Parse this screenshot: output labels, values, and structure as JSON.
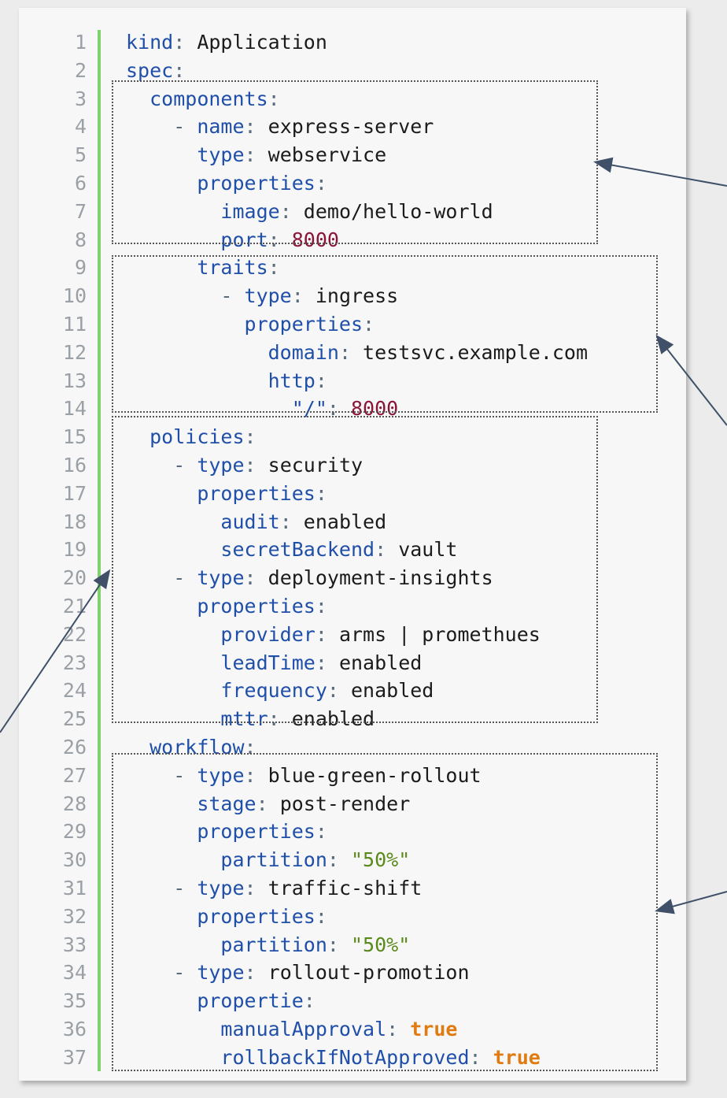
{
  "editor": {
    "lines": [
      {
        "num": "1",
        "indent": "",
        "key": "kind",
        "value": "Application",
        "vtype": "plain"
      },
      {
        "num": "2",
        "indent": "",
        "key": "spec",
        "value": "",
        "vtype": "plain"
      },
      {
        "num": "3",
        "indent": "  ",
        "key": "components",
        "value": "",
        "vtype": "plain"
      },
      {
        "num": "4",
        "indent": "    - ",
        "key": "name",
        "value": "express-server",
        "vtype": "plain"
      },
      {
        "num": "5",
        "indent": "      ",
        "key": "type",
        "value": "webservice",
        "vtype": "plain"
      },
      {
        "num": "6",
        "indent": "      ",
        "key": "properties",
        "value": "",
        "vtype": "plain"
      },
      {
        "num": "7",
        "indent": "        ",
        "key": "image",
        "value": "demo/hello-world",
        "vtype": "plain"
      },
      {
        "num": "8",
        "indent": "        ",
        "key": "port",
        "value": "8000",
        "vtype": "number"
      },
      {
        "num": "9",
        "indent": "      ",
        "key": "traits",
        "value": "",
        "vtype": "plain"
      },
      {
        "num": "10",
        "indent": "        - ",
        "key": "type",
        "value": "ingress",
        "vtype": "plain"
      },
      {
        "num": "11",
        "indent": "          ",
        "key": "properties",
        "value": "",
        "vtype": "plain"
      },
      {
        "num": "12",
        "indent": "            ",
        "key": "domain",
        "value": "testsvc.example.com",
        "vtype": "plain"
      },
      {
        "num": "13",
        "indent": "            ",
        "key": "http",
        "value": "",
        "vtype": "plain"
      },
      {
        "num": "14",
        "indent": "              ",
        "key": "\"/\"",
        "value": "8000",
        "vtype": "number"
      },
      {
        "num": "15",
        "indent": "  ",
        "key": "policies",
        "value": "",
        "vtype": "plain"
      },
      {
        "num": "16",
        "indent": "    - ",
        "key": "type",
        "value": "security",
        "vtype": "plain"
      },
      {
        "num": "17",
        "indent": "      ",
        "key": "properties",
        "value": "",
        "vtype": "plain"
      },
      {
        "num": "18",
        "indent": "        ",
        "key": "audit",
        "value": "enabled",
        "vtype": "plain"
      },
      {
        "num": "19",
        "indent": "        ",
        "key": "secretBackend",
        "value": "vault",
        "vtype": "plain"
      },
      {
        "num": "20",
        "indent": "    - ",
        "key": "type",
        "value": "deployment-insights",
        "vtype": "plain"
      },
      {
        "num": "21",
        "indent": "      ",
        "key": "properties",
        "value": "",
        "vtype": "plain"
      },
      {
        "num": "22",
        "indent": "        ",
        "key": "provider",
        "value": "arms | promethues",
        "vtype": "plain"
      },
      {
        "num": "23",
        "indent": "        ",
        "key": "leadTime",
        "value": "enabled",
        "vtype": "plain"
      },
      {
        "num": "24",
        "indent": "        ",
        "key": "frequency",
        "value": "enabled",
        "vtype": "plain"
      },
      {
        "num": "25",
        "indent": "        ",
        "key": "mttr",
        "value": "enabled",
        "vtype": "plain"
      },
      {
        "num": "26",
        "indent": "  ",
        "key": "workflow",
        "value": "",
        "vtype": "plain"
      },
      {
        "num": "27",
        "indent": "    - ",
        "key": "type",
        "value": "blue-green-rollout",
        "vtype": "plain"
      },
      {
        "num": "28",
        "indent": "      ",
        "key": "stage",
        "value": "post-render",
        "vtype": "plain"
      },
      {
        "num": "29",
        "indent": "      ",
        "key": "properties",
        "value": "",
        "vtype": "plain"
      },
      {
        "num": "30",
        "indent": "        ",
        "key": "partition",
        "value": "\"50%\"",
        "vtype": "string"
      },
      {
        "num": "31",
        "indent": "    - ",
        "key": "type",
        "value": "traffic-shift",
        "vtype": "plain"
      },
      {
        "num": "32",
        "indent": "      ",
        "key": "properties",
        "value": "",
        "vtype": "plain"
      },
      {
        "num": "33",
        "indent": "        ",
        "key": "partition",
        "value": "\"50%\"",
        "vtype": "string"
      },
      {
        "num": "34",
        "indent": "    - ",
        "key": "type",
        "value": "rollout-promotion",
        "vtype": "plain"
      },
      {
        "num": "35",
        "indent": "      ",
        "key": "propertie",
        "value": "",
        "vtype": "plain"
      },
      {
        "num": "36",
        "indent": "        ",
        "key": "manualApproval",
        "value": "true",
        "vtype": "bool"
      },
      {
        "num": "37",
        "indent": "        ",
        "key": "rollbackIfNotApproved",
        "value": "true",
        "vtype": "bool"
      }
    ]
  },
  "colors": {
    "key": "#1f4fa8",
    "number": "#8a1538",
    "string": "#5a8a1a",
    "boolean": "#e07b12",
    "gutter_bar": "#7fd26b"
  }
}
